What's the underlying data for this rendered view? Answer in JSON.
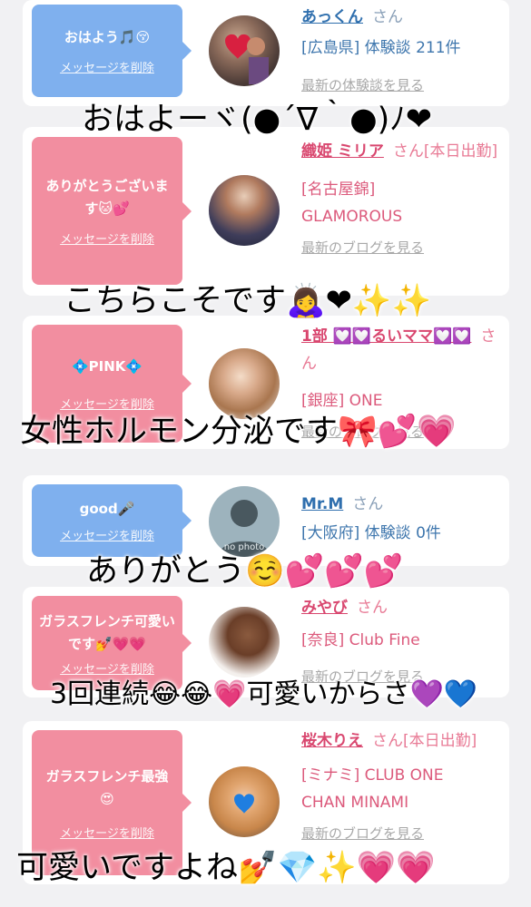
{
  "colors": {
    "bubble_blue": "#7fb0ee",
    "bubble_pink": "#f28ea0",
    "name_blue": "#2f6fae",
    "name_pink": "#d9476f",
    "overlay_heart": "#e0203a"
  },
  "cards": [
    {
      "message": "おはよう🎵😚",
      "delete_label": "メッセージを削除",
      "name": "あっくん",
      "honorific": "さん",
      "details": [
        "[広島県] 体験談 211件"
      ],
      "latest": "最新の体験談を見る"
    },
    {
      "message": "ありがとうございます🐱💕",
      "delete_label": "メッセージを削除",
      "name": "織姫 ミリア",
      "honorific": "さん[本日出勤]",
      "details": [
        "[名古屋錦] GLAMOROUS"
      ],
      "latest": "最新のブログを見る"
    },
    {
      "message": "💠PINK💠",
      "delete_label": "メッセージを削除",
      "name": "1部 💟💟るいママ💟💟",
      "honorific": "さん",
      "details": [
        "[銀座] ONE"
      ],
      "latest": "最新のブログを見る"
    },
    {
      "message": "good🎤",
      "delete_label": "メッセージを削除",
      "name": "Mr.M",
      "honorific": "さん",
      "details": [
        "[大阪府] 体験談 0件"
      ],
      "avatar_label": "no photo"
    },
    {
      "message": "ガラスフレンチ可愛いです💅💗💗",
      "delete_label": "メッセージを削除",
      "name": "みやび",
      "honorific": "さん",
      "details": [
        "[奈良] Club Fine"
      ],
      "latest": "最新のブログを見る"
    },
    {
      "message": "ガラスフレンチ最強😍",
      "delete_label": "メッセージを削除",
      "name": "桜木りえ",
      "honorific": "さん[本日出勤]",
      "details": [
        "[ミナミ] CLUB ONE CHAN MINAMI"
      ],
      "latest": "最新のブログを見る"
    }
  ],
  "overlays": [
    "おはよーヾ(●´∇｀●)ﾉ❤",
    "こちらこそです🙇‍♀️❤✨✨",
    "女性ホルモン分泌です🎀💕💗",
    "ありがとう☺️💕💕💕",
    "3回連続😂😂💗可愛いからさ💜💙",
    "可愛いですよね💅💎✨💗💗"
  ]
}
